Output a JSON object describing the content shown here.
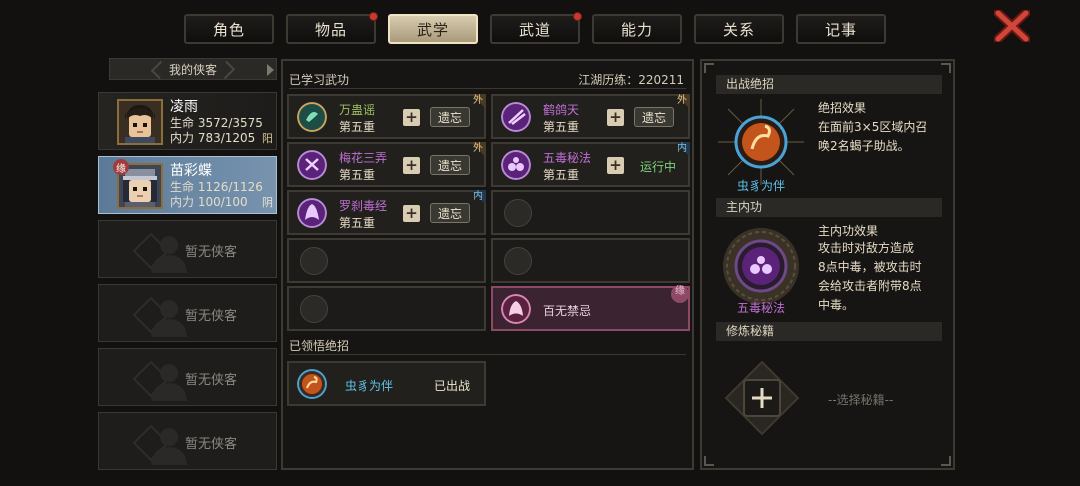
{
  "tabs": [
    {
      "label": "角色",
      "badge": false,
      "active": false
    },
    {
      "label": "物品",
      "badge": true,
      "active": false
    },
    {
      "label": "武学",
      "badge": false,
      "active": true
    },
    {
      "label": "武道",
      "badge": true,
      "active": false
    },
    {
      "label": "能力",
      "badge": false,
      "active": false
    },
    {
      "label": "关系",
      "badge": false,
      "active": false
    },
    {
      "label": "记事",
      "badge": false,
      "active": false
    }
  ],
  "roster": {
    "title": "我的侠客",
    "heroes": [
      {
        "name": "凌雨",
        "hp": "生命 3572/3575",
        "mp": "内力 783/1205",
        "align": "阳",
        "selected": false
      },
      {
        "name": "苗彩蝶",
        "hp": "生命 1126/1126",
        "mp": "内力 100/100",
        "align": "阴",
        "selected": true,
        "mark": "缘"
      }
    ],
    "empty_label": "暂无侠客"
  },
  "learned": {
    "title": "已学习武功",
    "experience": "江湖历练：220211",
    "forget_label": "遗忘",
    "plus": "+",
    "skills": [
      {
        "name": "万蛊谣",
        "level": "第五重",
        "tag": "外",
        "color": "#2f7a6a"
      },
      {
        "name": "鹤鸽天",
        "level": "第五重",
        "tag": "外",
        "color": "#6a2f8a"
      },
      {
        "name": "梅花三弄",
        "level": "第五重",
        "tag": "外",
        "color": "#6a2f8a"
      },
      {
        "name": "五毒秘法",
        "level": "第五重",
        "tag": "内",
        "color": "#6a2f8a",
        "status": "运行中"
      },
      {
        "name": "罗刹毒经",
        "level": "第五重",
        "tag": "内",
        "color": "#6a2f8a"
      }
    ],
    "special": {
      "name": "百无禁忌",
      "tag": "缘"
    }
  },
  "ultimates": {
    "title": "已领悟绝招",
    "items": [
      {
        "name": "虫豸为伴",
        "state": "已出战"
      }
    ]
  },
  "right": {
    "combat_title": "出战绝招",
    "combat_effect_label": "绝招效果",
    "combat_effect": [
      "在面前3×5区域内召",
      "唤2名蝎子助战。"
    ],
    "combat_name": "虫豸为伴",
    "inner_title": "主内功",
    "inner_effect_label": "主内功效果",
    "inner_effect": [
      "攻击时对敌方造成",
      "8点中毒，被攻击时",
      "会给攻击者附带8点",
      "中毒。"
    ],
    "inner_name": "五毒秘法",
    "book_title": "修炼秘籍",
    "book_plus": "+",
    "book_hint": "--选择秘籍--"
  }
}
